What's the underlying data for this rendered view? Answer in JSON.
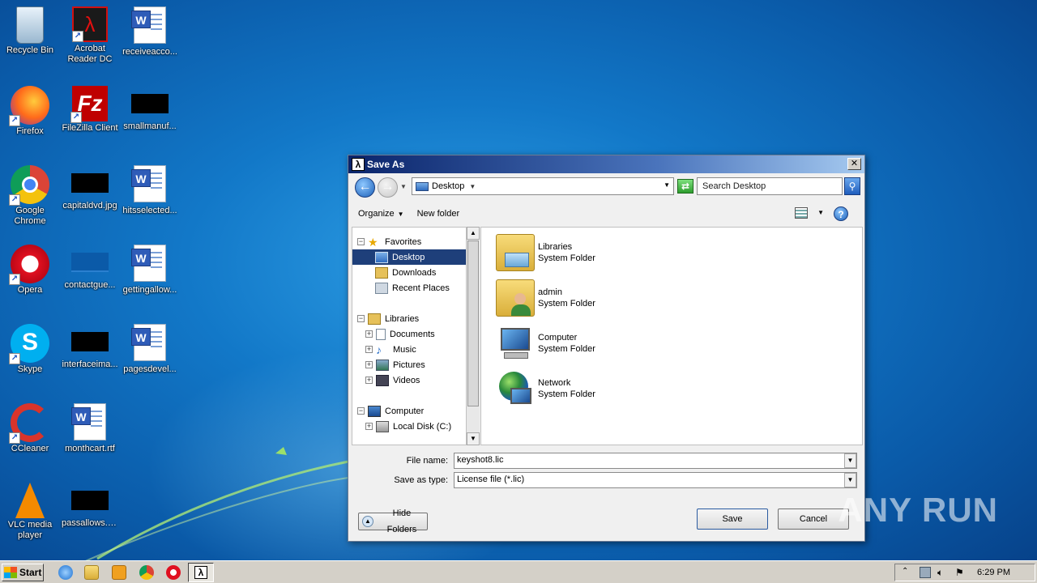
{
  "desktop": {
    "icons": [
      {
        "label": "Recycle Bin"
      },
      {
        "label": "Acrobat Reader DC"
      },
      {
        "label": "receiveacco..."
      },
      {
        "label": "Firefox"
      },
      {
        "label": "FileZilla Client"
      },
      {
        "label": "smallmanuf..."
      },
      {
        "label": "Google Chrome"
      },
      {
        "label": "capitaldvd.jpg"
      },
      {
        "label": "hitsselected..."
      },
      {
        "label": "Opera"
      },
      {
        "label": "contactgue..."
      },
      {
        "label": "gettingallow..."
      },
      {
        "label": "Skype"
      },
      {
        "label": "interfaceima..."
      },
      {
        "label": "pagesdevel..."
      },
      {
        "label": "CCleaner"
      },
      {
        "label": "monthcart.rtf"
      },
      {
        "label": "VLC media player"
      },
      {
        "label": "passallows.jpg"
      }
    ]
  },
  "dialog": {
    "title": "Save As",
    "address": "Desktop",
    "search_placeholder": "Search Desktop",
    "toolbar": {
      "organize": "Organize",
      "new_folder": "New folder"
    },
    "nav": {
      "favorites": "Favorites",
      "desktop": "Desktop",
      "downloads": "Downloads",
      "recent_places": "Recent Places",
      "libraries": "Libraries",
      "documents": "Documents",
      "music": "Music",
      "pictures": "Pictures",
      "videos": "Videos",
      "computer": "Computer",
      "local_disk": "Local Disk (C:)"
    },
    "items": [
      {
        "name": "Libraries",
        "type": "System Folder"
      },
      {
        "name": "admin",
        "type": "System Folder"
      },
      {
        "name": "Computer",
        "type": "System Folder"
      },
      {
        "name": "Network",
        "type": "System Folder"
      }
    ],
    "file_name_label": "File name:",
    "file_name": "keyshot8.lic",
    "save_type_label": "Save as type:",
    "save_type": "License file (*.lic)",
    "hide_folders": "Hide Folders",
    "save": "Save",
    "cancel": "Cancel"
  },
  "taskbar": {
    "start": "Start",
    "clock": "6:29 PM"
  },
  "watermark": "ANY RUN"
}
